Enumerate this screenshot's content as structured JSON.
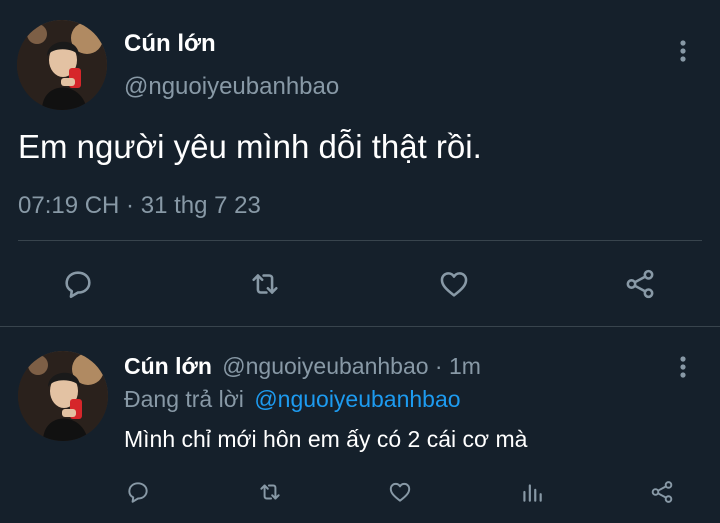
{
  "main_tweet": {
    "display_name": "Cún lớn",
    "handle": "@nguoiyeubanhbao",
    "text": "Em người yêu mình dỗi thật rồi.",
    "timestamp": "07:19 CH · 31 thg 7 23",
    "avatar_icon": "profile-photo-avatar",
    "more_icon": "more-vertical-icon",
    "actions": [
      "reply-icon",
      "retweet-icon",
      "like-icon",
      "share-icon"
    ]
  },
  "reply_tweet": {
    "display_name": "Cún lớn",
    "handle_time": "@nguoiyeubanhbao · 1m",
    "replying_prefix": "Đang trả lời",
    "replying_to": "@nguoiyeubanhbao",
    "text": "Mình chỉ mới hôn em ấy có 2 cái cơ mà",
    "avatar_icon": "profile-photo-avatar",
    "more_icon": "more-vertical-icon",
    "actions": [
      "reply-icon",
      "retweet-icon",
      "like-icon",
      "analytics-icon",
      "share-icon"
    ]
  },
  "colors": {
    "background": "#15202b",
    "primary_text": "#ffffff",
    "secondary_text": "#8899a6",
    "link": "#1d9bf0",
    "divider": "#38444d"
  }
}
